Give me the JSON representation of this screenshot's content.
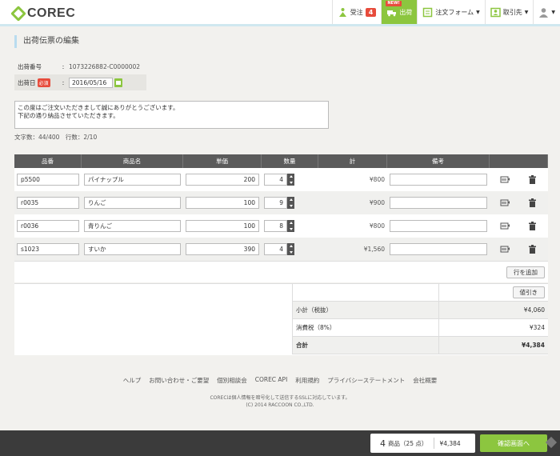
{
  "brand": {
    "name": "COREC"
  },
  "nav": {
    "orders": {
      "label": "受注",
      "count": "4"
    },
    "shipping": {
      "label": "出荷",
      "badge": "NEW!"
    },
    "order_form": {
      "label": "注文フォーム"
    },
    "customers": {
      "label": "取引先"
    }
  },
  "page": {
    "title": "出荷伝票の編集"
  },
  "meta": {
    "shipment_no_label": "出荷番号",
    "shipment_no": "1073226882-C0000002",
    "ship_date_label": "出荷日",
    "required_badge": "必須",
    "ship_date": "2016/05/16"
  },
  "memo": {
    "line1": "この度はご注文いただきまして誠にありがとうございます。",
    "line2": "下記の通り納品させていただきます。",
    "counter": "文字数：44/400　行数：2/10"
  },
  "table": {
    "headers": [
      "品番",
      "商品名",
      "単価",
      "数量",
      "計",
      "備考",
      ""
    ],
    "rows": [
      {
        "code": "p5500",
        "name": "パイナップル",
        "price": "200",
        "qty": "4",
        "total": "¥800",
        "note": ""
      },
      {
        "code": "r0035",
        "name": "りんご",
        "price": "100",
        "qty": "9",
        "total": "¥900",
        "note": ""
      },
      {
        "code": "r0036",
        "name": "青りんご",
        "price": "100",
        "qty": "8",
        "total": "¥800",
        "note": ""
      },
      {
        "code": "s1023",
        "name": "すいか",
        "price": "390",
        "qty": "4",
        "total": "¥1,560",
        "note": ""
      }
    ],
    "add_row_label": "行を追加"
  },
  "summary": {
    "discount_label": "値引き",
    "subtotal_label": "小計（税抜）",
    "subtotal": "¥4,060",
    "tax_label": "消費税（8%）",
    "tax": "¥324",
    "total_label": "合計",
    "total": "¥4,384"
  },
  "footer": {
    "links": [
      "ヘルプ",
      "お問い合わせ・ご要望",
      "個別相談会",
      "COREC API",
      "利用規約",
      "プライバシーステートメント",
      "会社概要"
    ],
    "ssl_note": "CORECは個人情報を暗号化して送信するSSLに対応しています。",
    "copyright": "(C) 2014 RACCOON CO.,LTD."
  },
  "cart": {
    "count": "4",
    "count_label": "商品（25 点）",
    "total": "¥4,384",
    "confirm_label": "確認画面へ"
  },
  "colors": {
    "accent": "#8cc63f",
    "header_dark": "#5b5b5b",
    "badge": "#e74c3c"
  }
}
